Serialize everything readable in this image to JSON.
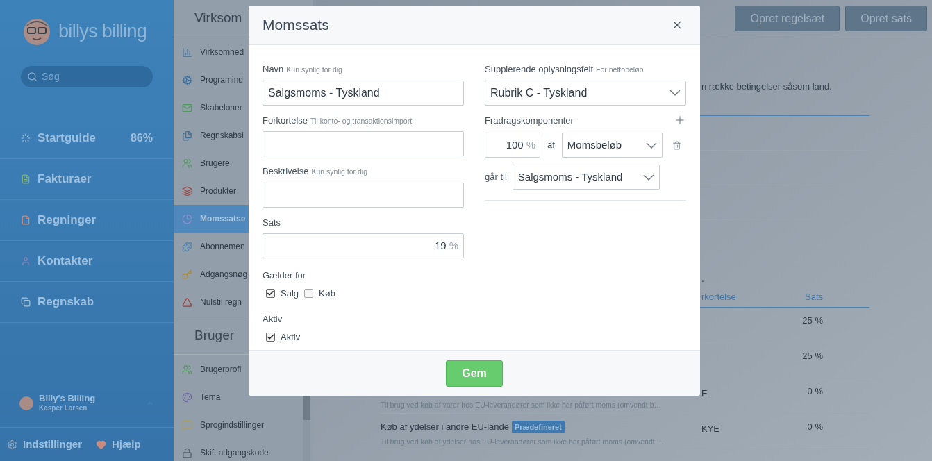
{
  "sidebar": {
    "logo_text": "billys billing",
    "search": {
      "placeholder": "Søg"
    },
    "items": [
      {
        "label": "Startguide",
        "badge": "86%"
      },
      {
        "label": "Fakturaer"
      },
      {
        "label": "Regninger"
      },
      {
        "label": "Kontakter"
      },
      {
        "label": "Regnskab"
      }
    ],
    "user": {
      "company": "Billy's Billing",
      "name": "Kasper Larsen"
    },
    "footer_links": [
      "Indstillinger",
      "Hjælp"
    ]
  },
  "settings_nav": {
    "sections": [
      {
        "title": "Virksom",
        "items": [
          {
            "label": "Virksomhed",
            "selected": false
          },
          {
            "label": "Programind",
            "selected": false
          },
          {
            "label": "Skabeloner",
            "selected": false
          },
          {
            "label": "Regnskabsi",
            "selected": false
          },
          {
            "label": "Brugere",
            "selected": false
          },
          {
            "label": "Produkter",
            "selected": false
          },
          {
            "label": "Momssatse",
            "selected": true
          },
          {
            "label": "Abonnemen",
            "selected": false
          },
          {
            "label": "Adgangsnøg",
            "selected": false
          },
          {
            "label": "Nulstil regn",
            "selected": false
          }
        ]
      },
      {
        "title": "Bruger",
        "items": [
          {
            "label": "Brugerprofi",
            "selected": false
          },
          {
            "label": "Tema",
            "selected": false
          },
          {
            "label": "Sprogindstillinger",
            "selected": false
          },
          {
            "label": "Skift adgangskode",
            "selected": false
          }
        ]
      }
    ]
  },
  "toolbar": {
    "buttons": [
      "Opret regelsæt",
      "Opret sats"
    ]
  },
  "main": {
    "intro": "n række betingelser såsom land.",
    "note": ".",
    "table": {
      "columns": [
        "rkortelse",
        "Sats"
      ],
      "rows": [
        {
          "rate": "25 %"
        },
        {
          "rate": "25 %"
        },
        {
          "abbreviation": "E",
          "rate": "0 %",
          "description": "Til brug ved køb af varer hos EU-leverandører som ikke har påført moms (omvendt b…"
        },
        {
          "name": "Køb af ydelser i andre EU-lande",
          "badge": "Prædefineret",
          "abbreviation": "KYE",
          "rate": "0 %",
          "description": "Til brug ved køb af ydelser hos EU-leverandører som ikke har påført moms (omvendt …"
        }
      ]
    }
  },
  "dialog": {
    "title": "Momssats",
    "fields": [
      {
        "label": "Navn",
        "hint": "Kun synlig for dig",
        "value": "Salgsmoms - Tyskland"
      },
      {
        "label": "Forkortelse",
        "hint": "Til konto- og transaktionsimport"
      },
      {
        "label": "Beskrivelse",
        "hint": "Kun synlig for dig"
      }
    ],
    "rate": {
      "label": "Sats",
      "value": "19",
      "unit": "%"
    },
    "applies_to": {
      "label": "Gælder for",
      "options": [
        {
          "label": "Salg",
          "checked": true
        },
        {
          "label": "Køb",
          "checked": false
        }
      ]
    },
    "active": {
      "label": "Aktiv",
      "options": [
        {
          "label": "Aktiv",
          "checked": true
        }
      ]
    },
    "extra_field": {
      "label": "Supplerende oplysningsfelt",
      "hint": "For nettobeløb",
      "value": "Rubrik C - Tyskland"
    },
    "deductions": {
      "label": "Fradragskomponenter",
      "items": [
        {
          "percent": "100",
          "unit": "%",
          "of_label": "af",
          "of_value": "Momsbeløb",
          "to_label": "går til",
          "to_value": "Salgsmoms - Tyskland"
        }
      ]
    },
    "save_button": "Gem"
  }
}
